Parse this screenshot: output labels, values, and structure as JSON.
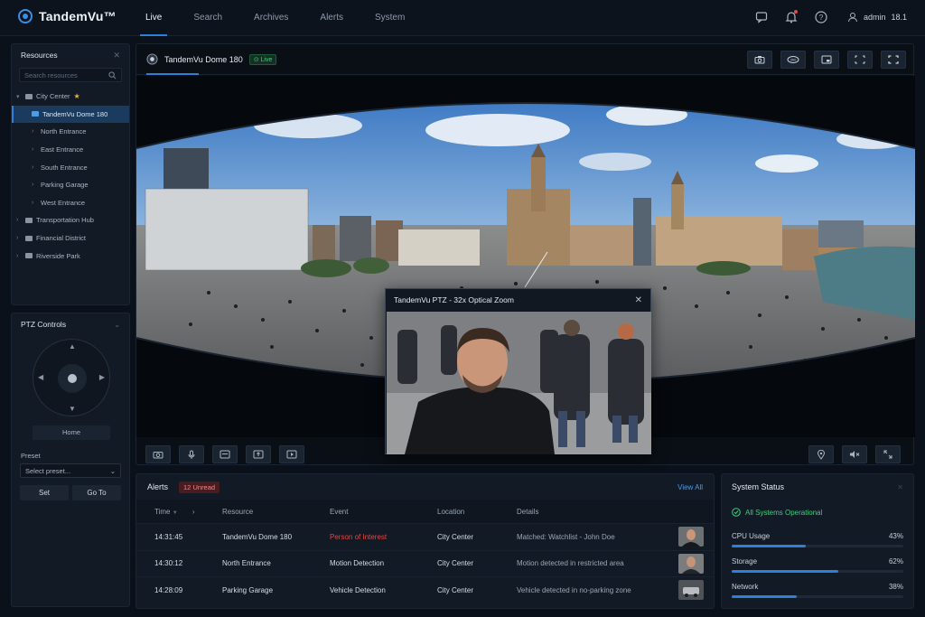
{
  "app": {
    "name": "TandemVu™"
  },
  "nav": {
    "items": [
      "Live",
      "Search",
      "Archives",
      "Alerts",
      "System"
    ],
    "active": "Live"
  },
  "user": {
    "name": "admin",
    "version": "18.1"
  },
  "resources": {
    "title": "Resources",
    "search_placeholder": "Search resources",
    "tree": [
      {
        "label": "City Center",
        "level": 0,
        "expanded": true,
        "starred": true
      },
      {
        "label": "TandemVu Dome 180",
        "level": 1,
        "selected": true
      },
      {
        "label": "North Entrance",
        "level": 1
      },
      {
        "label": "East Entrance",
        "level": 1
      },
      {
        "label": "South Entrance",
        "level": 1
      },
      {
        "label": "Parking Garage",
        "level": 1
      },
      {
        "label": "West Entrance",
        "level": 1
      },
      {
        "label": "Transportation Hub",
        "level": 0
      },
      {
        "label": "Financial District",
        "level": 0
      },
      {
        "label": "Riverside Park",
        "level": 0
      }
    ]
  },
  "ptz": {
    "title": "PTZ Controls",
    "home_label": "Home",
    "preset_label": "Preset",
    "preset_placeholder": "Select preset...",
    "set_label": "Set",
    "goto_label": "Go To"
  },
  "camera": {
    "name": "TandemVu Dome 180",
    "status": "Live"
  },
  "popup": {
    "title": "TandemVu PTZ - 32x Optical Zoom"
  },
  "alerts": {
    "title": "Alerts",
    "unread": "12 Unread",
    "view_all": "View All",
    "columns": [
      "Time",
      "Resource",
      "Event",
      "Location",
      "Details"
    ],
    "rows": [
      {
        "time": "14:31:45",
        "resource": "TandemVu Dome 180",
        "event": "Person of Interest",
        "location": "City Center",
        "details": "Matched: Watchlist - John Doe"
      },
      {
        "time": "14:30:12",
        "resource": "North Entrance",
        "event": "Motion Detection",
        "location": "City Center",
        "details": "Motion detected in restricted area"
      },
      {
        "time": "14:28:09",
        "resource": "Parking Garage",
        "event": "Vehicle Detection",
        "location": "City Center",
        "details": "Vehicle detected in no-parking zone"
      }
    ]
  },
  "system": {
    "title": "System Status",
    "overall": "All Systems Operational",
    "metrics": [
      {
        "label": "CPU Usage",
        "value": "43%",
        "fraction": 0.43
      },
      {
        "label": "Storage",
        "value": "62%",
        "fraction": 0.62
      },
      {
        "label": "Network",
        "value": "38%",
        "fraction": 0.38
      }
    ]
  },
  "colors": {
    "accent": "#2e7fd9",
    "danger": "#e5453f",
    "success": "#3fcf7c"
  }
}
